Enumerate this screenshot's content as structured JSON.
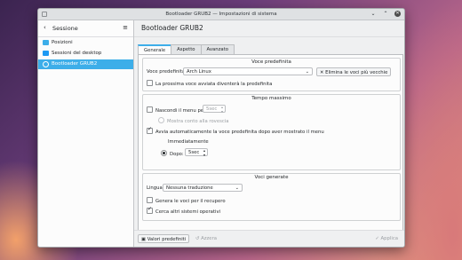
{
  "window": {
    "title": "Bootloader GRUB2 — Impostazioni di sistema"
  },
  "sidebar": {
    "title": "Sessione",
    "items": [
      {
        "label": "Posizioni",
        "color": "#3daee9"
      },
      {
        "label": "Sessioni del desktop",
        "color": "#3daee9"
      },
      {
        "label": "Bootloader GRUB2",
        "color": "#ffffff",
        "selected": true
      }
    ]
  },
  "main": {
    "title": "Bootloader GRUB2",
    "tabs": [
      {
        "label": "Generale",
        "active": true
      },
      {
        "label": "Aspetto"
      },
      {
        "label": "Avanzato"
      }
    ]
  },
  "default_entry": {
    "title": "Voce predefinita",
    "label": "Voce predefinita:",
    "value": "Arch Linux",
    "remove_old_button": "Elimina le voci più vecchie",
    "next_boot_checkbox": {
      "label": "La prossima voce avviata diventerà la predefinita",
      "checked": false
    }
  },
  "timeout": {
    "title": "Tempo massimo",
    "hide_menu": {
      "label": "Nascondi il menu per:",
      "checked": false,
      "value": "5sec"
    },
    "show_countdown": {
      "label": "Mostra conto alla rovescia",
      "checked": false
    },
    "autoboot": {
      "label": "Avvia automaticamente la voce predefinita dopo aver mostrato il menu",
      "checked": true
    },
    "immediately": {
      "label": "Immediatamente",
      "selected": false
    },
    "after": {
      "label": "Dopo:",
      "selected": true,
      "value": "5sec"
    }
  },
  "generated_entries": {
    "title": "Voci generate",
    "language_label": "Lingua:",
    "language_value": "Nessuna traduzione",
    "recovery": {
      "label": "Genera le voci per il recupero",
      "checked": false
    },
    "os_prober": {
      "label": "Cerca altri sistemi operativi",
      "checked": true
    }
  },
  "footer": {
    "defaults_button": "Valori predefiniti",
    "reset_button": "Azzera",
    "apply_button": "Applica"
  },
  "colors": {
    "accent": "#3daee9",
    "window_bg": "#eff0f1"
  }
}
